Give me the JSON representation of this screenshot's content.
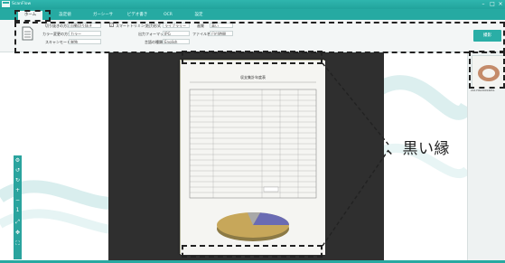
{
  "app": {
    "title": "ScanFlow"
  },
  "tabs": [
    {
      "label": "ホーム",
      "active": true
    },
    {
      "label": "設定値",
      "active": false
    },
    {
      "label": "ガーシーサ",
      "active": false
    },
    {
      "label": "ビデオ書き",
      "active": false
    },
    {
      "label": "OCR",
      "active": false
    },
    {
      "label": "設定",
      "active": false
    }
  ],
  "settings": {
    "auto_crop_label": "切り抜きの方法",
    "auto_crop_value": "自動切り抜き",
    "color_mode_label": "カラー変更の方式",
    "color_mode_value": "カラー",
    "scan_mode_label": "スキャンモード",
    "scan_mode_value": "単独",
    "smart_check_label": "スマートトリミング",
    "output_dir_label": "出力形式",
    "output_dir_value": "ライブラリー",
    "file_format_label": "出力フォーマット",
    "file_format_value": "JPG",
    "ocr_lang_label": "言語の種類",
    "ocr_lang_value": "English",
    "quality_label": "画質",
    "quality_value": "高い",
    "filename_label": "ファイル名",
    "filename_value": "日付時間"
  },
  "scan_button": "撮影",
  "thumbnail": {
    "name": "20170915094651"
  },
  "callout": {
    "text": "、黒い縁"
  },
  "document": {
    "title": "収支集計年度表",
    "table_rows": 8,
    "pie_colors": [
      "#c7a75a",
      "#6a6bb3",
      "#a8a8a8"
    ]
  },
  "colors": {
    "accent": "#2aaea6",
    "dark": "#2f2f2f"
  }
}
